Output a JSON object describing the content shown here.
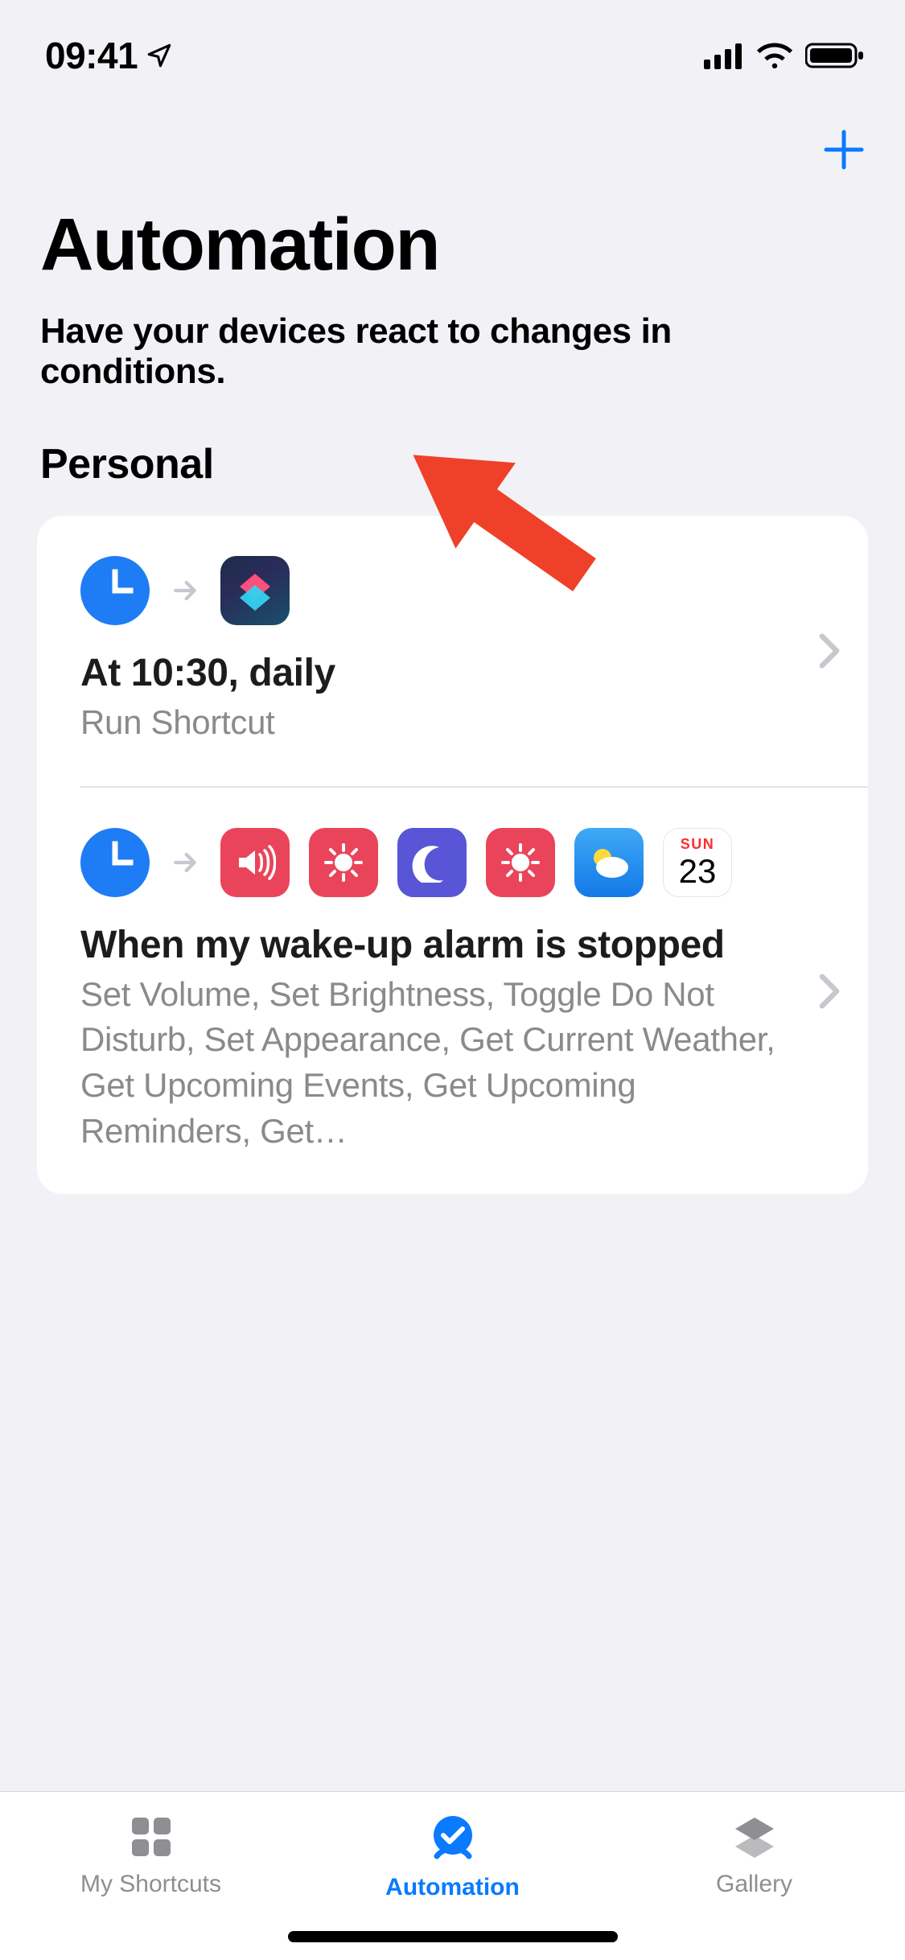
{
  "status": {
    "time": "09:41"
  },
  "header": {
    "title": "Automation",
    "subtitle": "Have your devices react to changes in conditions."
  },
  "section": {
    "label": "Personal"
  },
  "automations": [
    {
      "trigger_icon": "clock",
      "action_icons": [
        "shortcuts-app"
      ],
      "title": "At 10:30, daily",
      "subtitle": "Run Shortcut"
    },
    {
      "trigger_icon": "clock",
      "action_icons": [
        "volume",
        "brightness",
        "moon",
        "brightness",
        "weather",
        "calendar"
      ],
      "calendar": {
        "day": "SUN",
        "date": "23"
      },
      "title": "When my wake-up alarm is stopped",
      "subtitle": "Set Volume, Set Brightness, Toggle Do Not Disturb, Set Appearance, Get Current Weather, Get Upcoming Events, Get Upcoming Reminders, Get…"
    }
  ],
  "tabs": [
    {
      "label": "My Shortcuts",
      "active": false
    },
    {
      "label": "Automation",
      "active": true
    },
    {
      "label": "Gallery",
      "active": false
    }
  ]
}
